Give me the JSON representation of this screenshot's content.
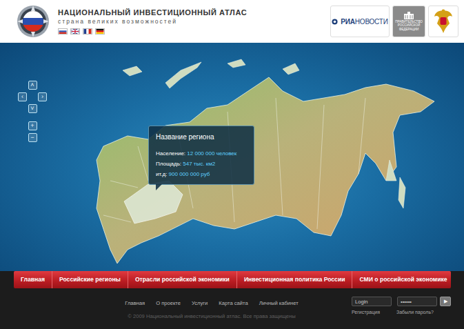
{
  "header": {
    "title": "НАЦИОНАЛЬНЫЙ ИНВЕСТИЦИОННЫЙ АТЛАС",
    "subtitle": "страна великих возможностей"
  },
  "partners": {
    "ria_bold": "РИА",
    "ria_rest": "НОВОСТИ",
    "government": [
      "ПРАВИТЕЛЬСТВО",
      "РОССИЙСКОЙ",
      "ФЕДЕРАЦИИ"
    ]
  },
  "map_controls": {
    "up": "˄",
    "left": "‹",
    "right": "›",
    "down": "˅",
    "zoom_in": "+",
    "zoom_out": "−"
  },
  "tooltip": {
    "title": "Название региона",
    "rows": [
      {
        "label": "Население:",
        "value": "12 000 000 человек"
      },
      {
        "label": "Площадь:",
        "value": "547 тыс. км2"
      },
      {
        "label": "ит.д:",
        "value": "900 000 000 руб"
      }
    ]
  },
  "menu": [
    "Главная",
    "Российские регионы",
    "Отрасли российской экономики",
    "Инвестиционная политика России",
    "СМИ о российской экономике"
  ],
  "footer": {
    "links": [
      "Главная",
      "О проекте",
      "Услуги",
      "Карта сайта",
      "Личный кабинет"
    ],
    "copyright": "© 2009 Национальный инвестиционный атлас. Все права защищены",
    "login": {
      "value": "Login"
    },
    "password": {
      "value": "••••••"
    },
    "submit": "▶",
    "register": "Регистрация",
    "forgot": "Забыли пароль?"
  }
}
